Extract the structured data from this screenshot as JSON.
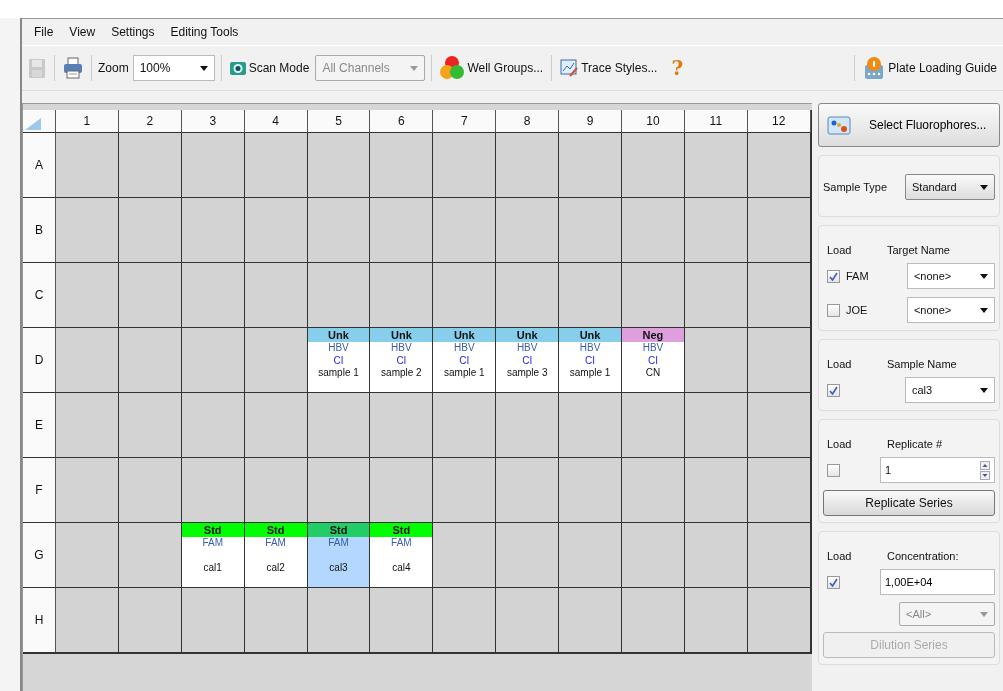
{
  "menu": [
    {
      "label": "File"
    },
    {
      "label": "View"
    },
    {
      "label": "Settings"
    },
    {
      "label": "Editing Tools"
    }
  ],
  "toolbar": {
    "save": {
      "disabled": true
    },
    "zoom": {
      "label": "Zoom",
      "value": "100%"
    },
    "scan_mode": {
      "label": "Scan Mode",
      "value": "All Channels",
      "disabled": true
    },
    "well_groups": {
      "label": "Well Groups..."
    },
    "trace_styles": {
      "label": "Trace Styles..."
    },
    "help": {
      "label": "?"
    },
    "plate_loading_guide": {
      "label": "Plate Loading Guide"
    }
  },
  "plate": {
    "columns": [
      "1",
      "2",
      "3",
      "4",
      "5",
      "6",
      "7",
      "8",
      "9",
      "10",
      "11",
      "12"
    ],
    "rows": [
      {
        "label": "A",
        "wells": [
          {
            "loaded": false
          },
          {
            "loaded": false
          },
          {
            "loaded": false
          },
          {
            "loaded": false
          },
          {
            "loaded": false
          },
          {
            "loaded": false
          },
          {
            "loaded": false
          },
          {
            "loaded": false
          },
          {
            "loaded": false
          },
          {
            "loaded": false
          },
          {
            "loaded": false
          },
          {
            "loaded": false
          }
        ]
      },
      {
        "label": "B",
        "wells": [
          {
            "loaded": false
          },
          {
            "loaded": false
          },
          {
            "loaded": false
          },
          {
            "loaded": false
          },
          {
            "loaded": false
          },
          {
            "loaded": false
          },
          {
            "loaded": false
          },
          {
            "loaded": false
          },
          {
            "loaded": false
          },
          {
            "loaded": false
          },
          {
            "loaded": false
          },
          {
            "loaded": false
          }
        ]
      },
      {
        "label": "C",
        "wells": [
          {
            "loaded": false
          },
          {
            "loaded": false
          },
          {
            "loaded": false
          },
          {
            "loaded": false
          },
          {
            "loaded": false
          },
          {
            "loaded": false
          },
          {
            "loaded": false
          },
          {
            "loaded": false
          },
          {
            "loaded": false
          },
          {
            "loaded": false
          },
          {
            "loaded": false
          },
          {
            "loaded": false
          }
        ]
      },
      {
        "label": "D",
        "wells": [
          {
            "loaded": false
          },
          {
            "loaded": false
          },
          {
            "loaded": false
          },
          {
            "loaded": false
          },
          {
            "loaded": true,
            "type": "Unk",
            "color": "#87ceeb",
            "target": "HBV",
            "group": "CI",
            "sample": "sample 1",
            "selected": false
          },
          {
            "loaded": true,
            "type": "Unk",
            "color": "#87ceeb",
            "target": "HBV",
            "group": "CI",
            "sample": "sample 2",
            "selected": false
          },
          {
            "loaded": true,
            "type": "Unk",
            "color": "#87ceeb",
            "target": "HBV",
            "group": "CI",
            "sample": "sample 1",
            "selected": false
          },
          {
            "loaded": true,
            "type": "Unk",
            "color": "#87ceeb",
            "target": "HBV",
            "group": "CI",
            "sample": "sample 3",
            "selected": false
          },
          {
            "loaded": true,
            "type": "Unk",
            "color": "#87ceeb",
            "target": "HBV",
            "group": "CI",
            "sample": "sample 1",
            "selected": false
          },
          {
            "loaded": true,
            "type": "Neg",
            "color": "#dda0dd",
            "target": "HBV",
            "group": "CI",
            "sample": "CN",
            "selected": false
          },
          {
            "loaded": false
          },
          {
            "loaded": false
          }
        ]
      },
      {
        "label": "E",
        "wells": [
          {
            "loaded": false
          },
          {
            "loaded": false
          },
          {
            "loaded": false
          },
          {
            "loaded": false
          },
          {
            "loaded": false
          },
          {
            "loaded": false
          },
          {
            "loaded": false
          },
          {
            "loaded": false
          },
          {
            "loaded": false
          },
          {
            "loaded": false
          },
          {
            "loaded": false
          },
          {
            "loaded": false
          }
        ]
      },
      {
        "label": "F",
        "wells": [
          {
            "loaded": false
          },
          {
            "loaded": false
          },
          {
            "loaded": false
          },
          {
            "loaded": false
          },
          {
            "loaded": false
          },
          {
            "loaded": false
          },
          {
            "loaded": false
          },
          {
            "loaded": false
          },
          {
            "loaded": false
          },
          {
            "loaded": false
          },
          {
            "loaded": false
          },
          {
            "loaded": false
          }
        ]
      },
      {
        "label": "G",
        "wells": [
          {
            "loaded": false
          },
          {
            "loaded": false
          },
          {
            "loaded": true,
            "type": "Std",
            "color": "#00ff00",
            "target": "FAM",
            "sample": "cal1",
            "selected": false
          },
          {
            "loaded": true,
            "type": "Std",
            "color": "#00ff00",
            "target": "FAM",
            "sample": "cal2",
            "selected": false
          },
          {
            "loaded": true,
            "type": "Std",
            "color": "#22cc66",
            "target": "FAM",
            "sample": "cal3",
            "selected": true
          },
          {
            "loaded": true,
            "type": "Std",
            "color": "#00ff00",
            "target": "FAM",
            "sample": "cal4",
            "selected": false
          },
          {
            "loaded": false
          },
          {
            "loaded": false
          },
          {
            "loaded": false
          },
          {
            "loaded": false
          },
          {
            "loaded": false
          },
          {
            "loaded": false
          }
        ]
      },
      {
        "label": "H",
        "wells": [
          {
            "loaded": false
          },
          {
            "loaded": false
          },
          {
            "loaded": false
          },
          {
            "loaded": false
          },
          {
            "loaded": false
          },
          {
            "loaded": false
          },
          {
            "loaded": false
          },
          {
            "loaded": false
          },
          {
            "loaded": false
          },
          {
            "loaded": false
          },
          {
            "loaded": false
          },
          {
            "loaded": false
          }
        ]
      }
    ]
  },
  "panel": {
    "select_fluorophores": "Select Fluorophores...",
    "sample_type": {
      "label": "Sample Type",
      "value": "Standard"
    },
    "targets": {
      "load_label": "Load",
      "label": "Target Name",
      "rows": [
        {
          "fluor": "FAM",
          "checked": true,
          "value": "<none>"
        },
        {
          "fluor": "JOE",
          "checked": false,
          "value": "<none>"
        }
      ]
    },
    "sample_name": {
      "load_label": "Load",
      "label": "Sample Name",
      "checked": true,
      "value": "cal3"
    },
    "replicate": {
      "load_label": "Load",
      "label": "Replicate #",
      "checked": false,
      "value": "1",
      "button": "Replicate Series"
    },
    "concentration": {
      "load_label": "Load",
      "label": "Concentration:",
      "checked": true,
      "value": "1,00E+04",
      "units": {
        "value": "<All>",
        "disabled": true
      },
      "button": {
        "label": "Dilution Series",
        "disabled": true
      }
    }
  }
}
